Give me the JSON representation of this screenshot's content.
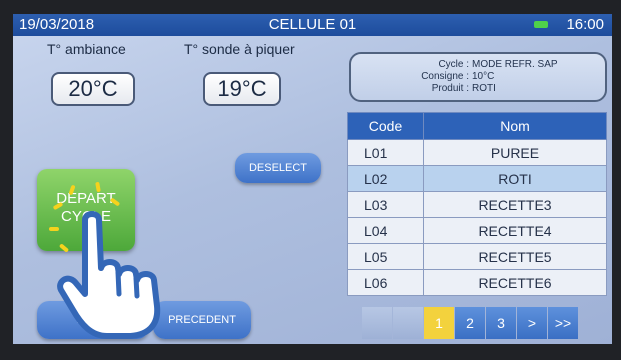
{
  "header": {
    "date": "19/03/2018",
    "title": "CELLULE 01",
    "time": "16:00"
  },
  "ambient": {
    "label": "T° ambiance",
    "value": "20°C"
  },
  "probe": {
    "label": "T° sonde à piquer",
    "value": "19°C"
  },
  "cycle_info": {
    "rows": [
      {
        "key": "Cycle :",
        "value": "MODE REFR. SAP"
      },
      {
        "key": "Consigne :",
        "value": "10°C"
      },
      {
        "key": "Produit :",
        "value": "ROTI"
      }
    ]
  },
  "table": {
    "headers": [
      "Code",
      "Nom"
    ],
    "rows": [
      {
        "code": "L01",
        "nom": "PUREE"
      },
      {
        "code": "L02",
        "nom": "ROTI"
      },
      {
        "code": "L03",
        "nom": "RECETTE3"
      },
      {
        "code": "L04",
        "nom": "RECETTE4"
      },
      {
        "code": "L05",
        "nom": "RECETTE5"
      },
      {
        "code": "L06",
        "nom": "RECETTE6"
      }
    ]
  },
  "buttons": {
    "deselect": "DESELECT",
    "depart_cycle": "DEPART CYCLE",
    "menu": "MENU",
    "precedent": "PRECEDENT"
  },
  "pagination": {
    "pages": [
      "",
      "",
      "1",
      "2",
      "3",
      ">",
      ">>"
    ],
    "active": "1"
  },
  "colors": {
    "header_blue": "#2d62b8",
    "start_green": "#5bb83f",
    "active_page": "#f3d23d"
  },
  "icons": {
    "pointer": "pointing-hand-icon",
    "battery": "battery-icon"
  }
}
